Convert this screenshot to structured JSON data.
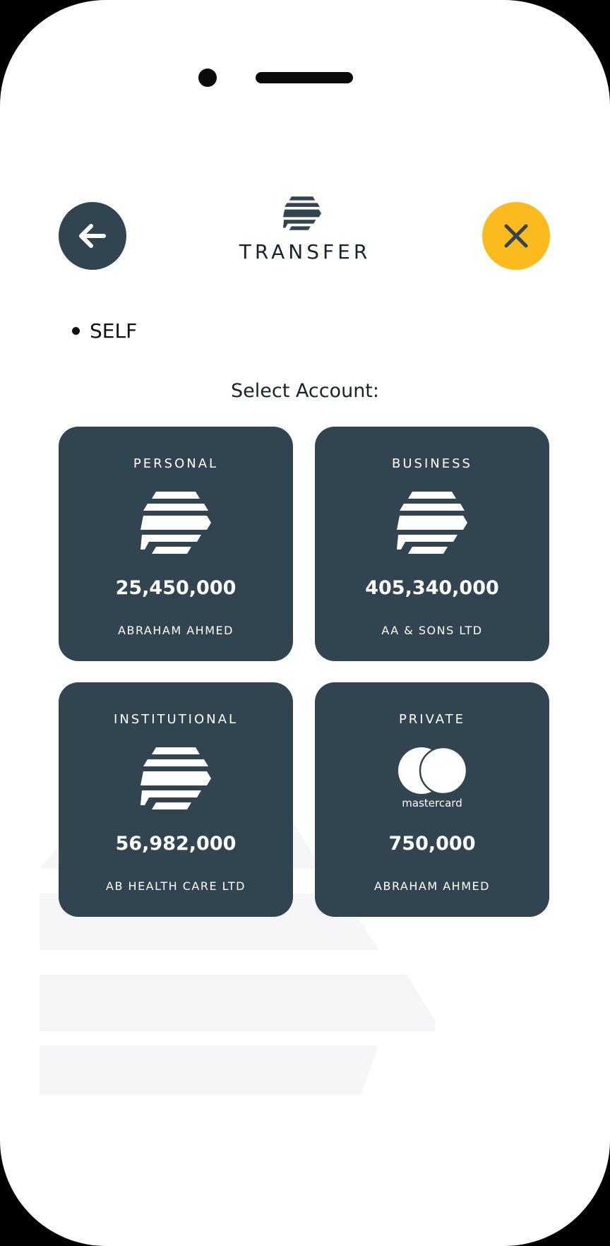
{
  "header": {
    "title": "TRANSFER",
    "back_icon": "arrow-left-icon",
    "close_icon": "close-icon",
    "colors": {
      "dark": "#32444f",
      "accent": "#fbba1e"
    }
  },
  "transfer_type": "SELF",
  "select_label": "Select Account:",
  "accounts": [
    {
      "type": "PERSONAL",
      "amount": "25,450,000",
      "holder": "ABRAHAM AHMED",
      "icon": "bank-logo-icon"
    },
    {
      "type": "BUSINESS",
      "amount": "405,340,000",
      "holder": "AA & SONS LTD",
      "icon": "bank-logo-icon"
    },
    {
      "type": "INSTITUTIONAL",
      "amount": "56,982,000",
      "holder": "AB HEALTH CARE LTD",
      "icon": "bank-logo-icon"
    },
    {
      "type": "PRIVATE",
      "amount": "750,000",
      "holder": "ABRAHAM AHMED",
      "icon": "mastercard-logo-icon",
      "brand": "mastercard"
    }
  ]
}
